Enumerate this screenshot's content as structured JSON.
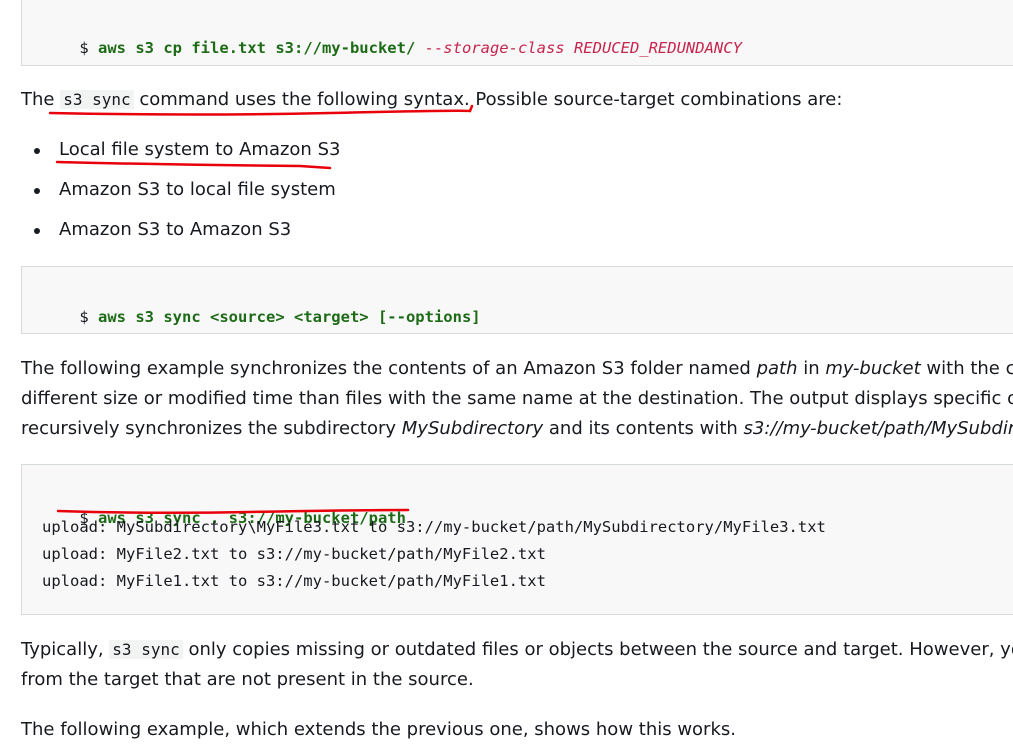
{
  "code_block_1": {
    "prompt": "$",
    "command": "aws s3 cp file.txt s3://my-bucket/",
    "option": "--storage-class REDUCED_REDUNDANCY"
  },
  "para_sync": {
    "before": "The ",
    "code": "s3 sync",
    "after": " command uses the following syntax. Possible source-target combinations are:"
  },
  "list": {
    "items": [
      "Local file system to Amazon S3",
      "Amazon S3 to local file system",
      "Amazon S3 to Amazon S3"
    ]
  },
  "code_block_2": {
    "prompt": "$",
    "command": "aws s3 sync <source> <target> [--options]"
  },
  "para_example": {
    "line1_a": "The following example synchronizes the contents of an Amazon S3 folder named ",
    "line1_em1": "path",
    "line1_b": " in ",
    "line1_em2": "my-bucket",
    "line1_c": " with the c",
    "line2": "different size or modified time than files with the same name at the destination. The output displays specific o",
    "line3_a": "recursively synchronizes the subdirectory ",
    "line3_em1": "MySubdirectory",
    "line3_b": " and its contents with ",
    "line3_em2": "s3://my-bucket/path/MySubdir"
  },
  "code_block_3": {
    "prompt": "$",
    "command": "aws s3 sync . s3://my-bucket/path",
    "output": [
      "upload: MySubdirectory\\MyFile3.txt to s3://my-bucket/path/MySubdirectory/MyFile3.txt",
      "upload: MyFile2.txt to s3://my-bucket/path/MyFile2.txt",
      "upload: MyFile1.txt to s3://my-bucket/path/MyFile1.txt"
    ]
  },
  "para_typically": {
    "line1_a": "Typically, ",
    "line1_code": "s3 sync",
    "line1_b": " only copies missing or outdated files or objects between the source and target. However, yo",
    "line2": "from the target that are not present in the source."
  },
  "para_following": {
    "text": "The following example, which extends the previous one, shows how this works."
  },
  "colors": {
    "annotation_red": "#e8000b",
    "command_green": "#1d6b16",
    "option_red": "#c7254e"
  }
}
